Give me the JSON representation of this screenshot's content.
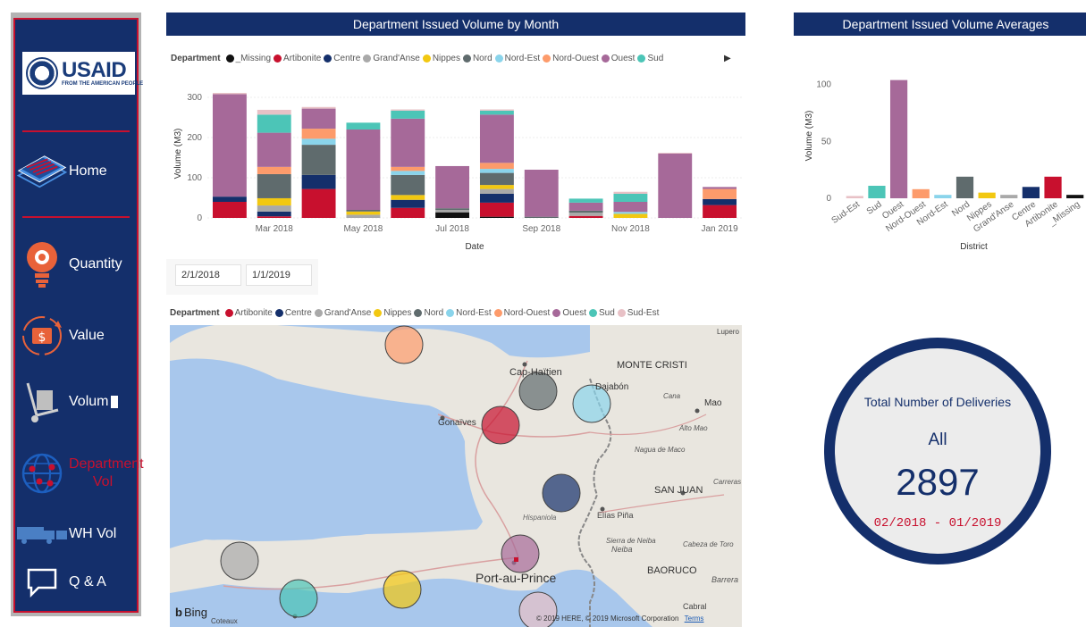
{
  "sidebar": {
    "logo_text": "USAID",
    "logo_sub": "FROM THE AMERICAN PEOPLE",
    "items": [
      {
        "label": "Home",
        "icon": "stack-icon"
      },
      {
        "label": "Quantity",
        "icon": "lightbulb-gear-icon"
      },
      {
        "label": "Value",
        "icon": "money-cycle-icon"
      },
      {
        "label": "Volum",
        "icon": "hand-truck-icon"
      },
      {
        "label": "Department Vol",
        "icon": "globe-network-icon",
        "active": true
      },
      {
        "label": "WH Vol",
        "icon": "truck-icon"
      },
      {
        "label": "Q & A",
        "icon": "chat-bubble-icon"
      }
    ]
  },
  "colors": {
    "navy": "#142f6b",
    "red": "#c8102e"
  },
  "departments": [
    {
      "name": "_Missing",
      "color": "#111111"
    },
    {
      "name": "Artibonite",
      "color": "#c8102e"
    },
    {
      "name": "Centre",
      "color": "#142f6b"
    },
    {
      "name": "Grand'Anse",
      "color": "#a9a9a9"
    },
    {
      "name": "Nippes",
      "color": "#f2c811"
    },
    {
      "name": "Nord",
      "color": "#5f6b6d"
    },
    {
      "name": "Nord-Est",
      "color": "#8ad4eb"
    },
    {
      "name": "Nord-Ouest",
      "color": "#fd9b6b"
    },
    {
      "name": "Ouest",
      "color": "#a66999"
    },
    {
      "name": "Sud",
      "color": "#4cc5b7"
    },
    {
      "name": "Sud-Est",
      "color": "#e8c1c6"
    }
  ],
  "monthly_panel": {
    "title": "Department Issued Volume by Month",
    "legend_title": "Department",
    "legend_items": [
      "_Missing",
      "Artibonite",
      "Centre",
      "Grand'Anse",
      "Nippes",
      "Nord",
      "Nord-Est",
      "Nord-Ouest",
      "Ouest",
      "Sud"
    ],
    "legend_arrow": "▶"
  },
  "averages_panel": {
    "title": "Department Issued Volume Averages"
  },
  "date_filter": {
    "start": "2/1/2018",
    "end": "1/1/2019"
  },
  "map_panel": {
    "legend_title": "Department",
    "legend_items": [
      "Artibonite",
      "Centre",
      "Grand'Anse",
      "Nippes",
      "Nord",
      "Nord-Est",
      "Nord-Ouest",
      "Ouest",
      "Sud",
      "Sud-Est"
    ],
    "place_labels": [
      "Cap-Haïtien",
      "MONTE CRISTI",
      "Dajabón",
      "Gonaïves",
      "Mao",
      "Hispaniola",
      "SAN JUAN",
      "Elías Piña",
      "Port-au-Prince",
      "BAORUCO",
      "Neiba",
      "Cabral",
      "Barrera",
      "Coteaux",
      "Lupero",
      "Cana",
      "Alto Mao",
      "Nagua de Maco",
      "Carreras",
      "Cabeza de Toro",
      "Sierra de Neiba"
    ],
    "attribution": "© 2019 HERE, © 2019 Microsoft Corporation",
    "terms": "Terms",
    "bing": "Bing"
  },
  "kpi": {
    "title": "Total Number of Deliveries",
    "filter": "All",
    "value": "2897",
    "range": "02/2018 - 01/2019"
  },
  "chart_data": [
    {
      "type": "bar",
      "stacked": true,
      "title": "Department Issued Volume by Month",
      "xlabel": "Date",
      "ylabel": "Volume (M3)",
      "ylim": [
        0,
        320
      ],
      "yticks": [
        0,
        100,
        200,
        300
      ],
      "categories": [
        "Feb 2018",
        "Mar 2018",
        "Apr 2018",
        "May 2018",
        "Jun 2018",
        "Jul 2018",
        "Aug 2018",
        "Sep 2018",
        "Oct 2018",
        "Nov 2018",
        "Dec 2018",
        "Jan 2019"
      ],
      "xtick_labels": [
        "Mar 2018",
        "May 2018",
        "Jul 2018",
        "Sep 2018",
        "Nov 2018",
        "Jan 2019"
      ],
      "xtick_indices": [
        1,
        3,
        5,
        7,
        9,
        11
      ],
      "series": [
        {
          "name": "_Missing",
          "values": [
            0,
            0,
            0,
            0,
            0,
            14,
            3,
            0,
            0,
            0,
            0,
            0
          ]
        },
        {
          "name": "Artibonite",
          "values": [
            40,
            4,
            72,
            0,
            25,
            0,
            35,
            0,
            5,
            0,
            0,
            32
          ]
        },
        {
          "name": "Centre",
          "values": [
            13,
            12,
            35,
            0,
            20,
            0,
            22,
            0,
            0,
            0,
            0,
            15
          ]
        },
        {
          "name": "Grand'Anse",
          "values": [
            0,
            15,
            0,
            8,
            0,
            6,
            12,
            0,
            8,
            0,
            0,
            0
          ]
        },
        {
          "name": "Nippes",
          "values": [
            0,
            18,
            0,
            8,
            12,
            0,
            10,
            0,
            0,
            10,
            0,
            0
          ]
        },
        {
          "name": "Nord",
          "values": [
            0,
            60,
            75,
            4,
            50,
            4,
            30,
            3,
            5,
            0,
            0,
            0
          ]
        },
        {
          "name": "Nord-Est",
          "values": [
            0,
            0,
            15,
            0,
            10,
            0,
            10,
            0,
            0,
            5,
            0,
            0
          ]
        },
        {
          "name": "Nord-Ouest",
          "values": [
            0,
            18,
            25,
            0,
            10,
            0,
            15,
            0,
            0,
            0,
            0,
            25
          ]
        },
        {
          "name": "Ouest",
          "values": [
            255,
            85,
            50,
            200,
            120,
            105,
            120,
            117,
            20,
            25,
            160,
            5
          ]
        },
        {
          "name": "Sud",
          "values": [
            0,
            45,
            0,
            17,
            20,
            0,
            10,
            0,
            10,
            20,
            0,
            0
          ]
        },
        {
          "name": "Sud-Est",
          "values": [
            3,
            12,
            4,
            0,
            3,
            0,
            3,
            0,
            0,
            5,
            2,
            0
          ]
        }
      ]
    },
    {
      "type": "bar",
      "title": "Department Issued Volume Averages",
      "xlabel": "District",
      "ylabel": "Volume (M3)",
      "ylim": [
        0,
        110
      ],
      "yticks": [
        0,
        50,
        100
      ],
      "categories": [
        "Sud-Est",
        "Sud",
        "Ouest",
        "Nord-Ouest",
        "Nord-Est",
        "Nord",
        "Nippes",
        "Grand'Anse",
        "Centre",
        "Artibonite",
        "_Missing"
      ],
      "values": [
        2,
        11,
        104,
        8,
        3,
        19,
        5,
        3,
        10,
        19,
        3
      ]
    },
    {
      "type": "map",
      "legend": "Department",
      "bubbles": [
        {
          "name": "Nord-Ouest"
        },
        {
          "name": "Nord"
        },
        {
          "name": "Nord-Est"
        },
        {
          "name": "Artibonite"
        },
        {
          "name": "Centre"
        },
        {
          "name": "Ouest"
        },
        {
          "name": "Grand'Anse"
        },
        {
          "name": "Sud"
        },
        {
          "name": "Nippes"
        },
        {
          "name": "Sud-Est"
        }
      ]
    }
  ]
}
